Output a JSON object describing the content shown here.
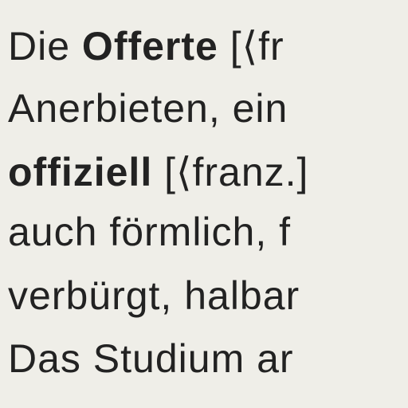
{
  "lines": [
    {
      "pre": "Die ",
      "bold": "Offerte",
      "post": " [⟨fr"
    },
    {
      "pre": "Anerbieten, ein ",
      "bold": "",
      "post": ""
    },
    {
      "pre": "",
      "bold": "offiziell",
      "post": " [⟨franz.]"
    },
    {
      "pre": "auch förmlich, f",
      "bold": "",
      "post": ""
    },
    {
      "pre": "verbürgt, halbar",
      "bold": "",
      "post": ""
    },
    {
      "pre": "Das Studium ar",
      "bold": "",
      "post": ""
    }
  ]
}
